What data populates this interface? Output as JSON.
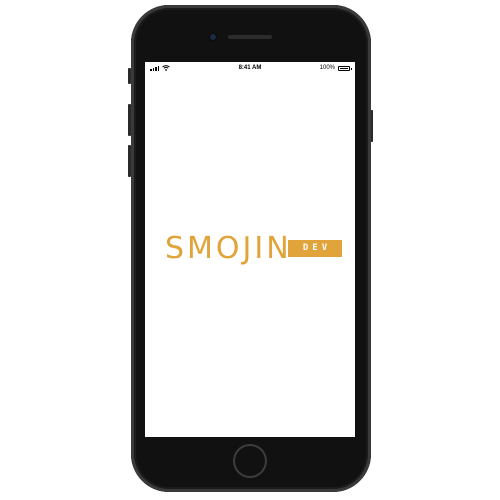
{
  "status_bar": {
    "time": "8:41 AM",
    "battery_percent": "100%",
    "battery_level": 1.0,
    "signal_bars": 4,
    "icons": [
      "signal-icon",
      "wifi-icon",
      "battery-icon"
    ]
  },
  "app": {
    "logo_text": "SMOJIN",
    "badge_text": "DEV",
    "brand_color": "#e0a43a",
    "background_color": "#ffffff"
  },
  "device": {
    "frame_color": "#111111",
    "screen_color": "#ffffff"
  }
}
